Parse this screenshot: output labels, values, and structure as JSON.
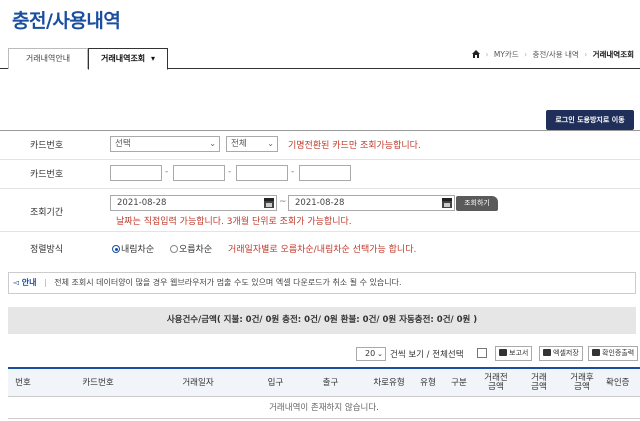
{
  "page": {
    "title": "충전/사용내역"
  },
  "tabs": [
    {
      "label": "거래내역안내"
    },
    {
      "label": "거래내역조회",
      "arrow": "▾"
    }
  ],
  "breadcrumb": {
    "home_icon": "home-icon",
    "items": [
      "MY카드",
      "충전/사용 내역",
      "거래내역조회"
    ]
  },
  "login_button": "로그인 도용방지로 이동",
  "form": {
    "card_select_label": "카드번호",
    "card_select_value": "선택",
    "card_type_value": "전체",
    "card_select_note": "기명전환된 카드만 조회가능합니다.",
    "card_number_label": "카드번호",
    "dash": "-",
    "period_label": "조회기간",
    "date_from": "2021-08-28",
    "date_to": "2021-08-28",
    "tilde": "~",
    "search_button": "조회하기",
    "period_note": "날짜는 직접입력 가능합니다. 3개월 단위로 조회가 가능합니다.",
    "sort_label": "정렬방식",
    "sort_desc": "내림차순",
    "sort_asc": "오름차순",
    "sort_note": "거래일자별로 오름차순/내림차순 선택가능 합니다."
  },
  "notice": {
    "tag": "안내",
    "text": "전체 조회시 데이터양이 많을 경우 웹브라우저가 멈출 수도 있으며 엑셀 다운로드가 취소 될 수 있습니다."
  },
  "summary": "사용건수/금액( 지불: 0건/ 0원 충전: 0건/ 0원 환불: 0건/ 0원 자동충전: 0건/ 0원 )",
  "toolbar": {
    "page_size": "20",
    "view_all": "건씩 보기 / 전체선택",
    "report_button": "보고서",
    "excel_button": "엑셀저장",
    "confirm_button": "확인증출력"
  },
  "table": {
    "headers": [
      "번호",
      "카드번호",
      "거래일자",
      "입구",
      "출구",
      "차로유형",
      "유형",
      "구분",
      "거래전\n금액",
      "거래\n금액",
      "거래후\n금액",
      "확인증"
    ],
    "empty_message": "거래내역이 존재하지 않습니다."
  },
  "colors": {
    "accent": "#1a4fa0",
    "dark_button": "#1f2f5a",
    "note_red": "#c0392b"
  }
}
